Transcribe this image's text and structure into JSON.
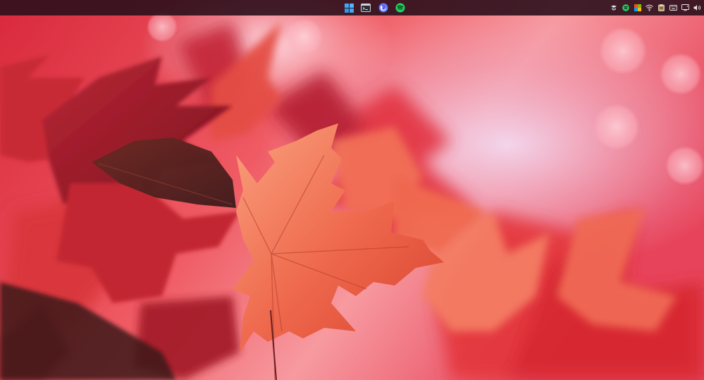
{
  "taskbar": {
    "pinned_apps": [
      {
        "name": "start",
        "icon": "windows-logo-icon",
        "color": "#3fa9f5"
      },
      {
        "name": "terminal",
        "icon": "terminal-icon",
        "color": "#cfd3da"
      },
      {
        "name": "firefox",
        "icon": "firefox-icon",
        "color": "#5a7bff"
      },
      {
        "name": "spotify",
        "icon": "spotify-icon",
        "color": "#1ed760"
      }
    ],
    "tray_icons": [
      "network-app-icon",
      "spotify-tray-icon",
      "color-picker-icon",
      "wifi-icon",
      "clipboard-icon",
      "keyboard-icon",
      "display-icon",
      "volume-icon"
    ]
  },
  "wallpaper": {
    "subject": "red-maple-leaves",
    "palette": [
      "#e83a45",
      "#f4805d",
      "#ffd4c2",
      "#8c1c2b",
      "#c9b6e4"
    ]
  }
}
